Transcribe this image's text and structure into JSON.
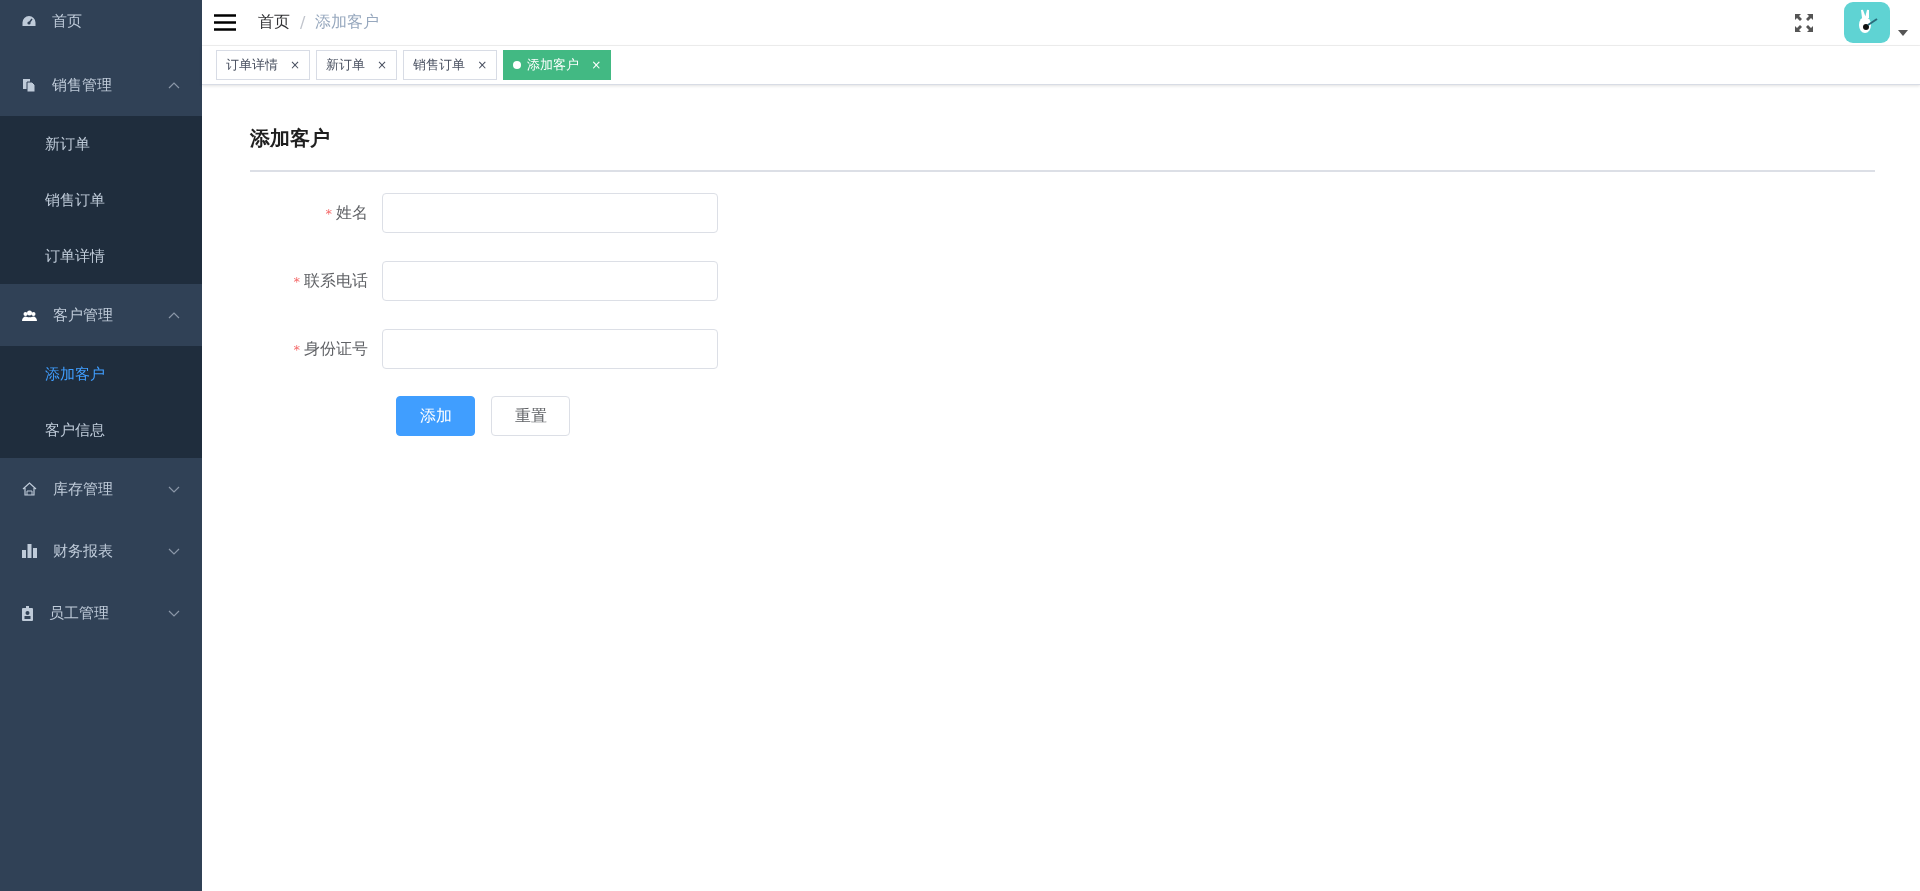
{
  "sidebar": {
    "items": [
      {
        "label": "首页",
        "selected": false
      },
      {
        "label": "销售管理",
        "expanded": true,
        "selected": false,
        "children": [
          {
            "label": "新订单",
            "selected": false
          },
          {
            "label": "销售订单",
            "selected": false
          },
          {
            "label": "订单详情",
            "selected": false
          }
        ]
      },
      {
        "label": "客户管理",
        "expanded": true,
        "selected": false,
        "children": [
          {
            "label": "添加客户",
            "selected": true
          },
          {
            "label": "客户信息",
            "selected": false
          }
        ]
      },
      {
        "label": "库存管理",
        "expanded": false,
        "selected": false
      },
      {
        "label": "财务报表",
        "expanded": false,
        "selected": false
      },
      {
        "label": "员工管理",
        "expanded": false,
        "selected": false
      }
    ]
  },
  "breadcrumb": {
    "separator": "/",
    "items": [
      "首页",
      "添加客户"
    ]
  },
  "tabs": [
    {
      "label": "订单详情",
      "selected": false,
      "close": "×"
    },
    {
      "label": "新订单",
      "selected": false,
      "close": "×"
    },
    {
      "label": "销售订单",
      "selected": false,
      "close": "×"
    },
    {
      "label": "添加客户",
      "selected": true,
      "close": "×"
    }
  ],
  "form": {
    "title": "添加客户",
    "fields": [
      {
        "label": "姓名",
        "required_mark": "*"
      },
      {
        "label": "联系电话",
        "required_mark": "*"
      },
      {
        "label": "身份证号",
        "required_mark": "*"
      }
    ],
    "buttons": [
      {
        "label": "添加",
        "kind": "primary"
      },
      {
        "label": "重置",
        "kind": "default"
      }
    ]
  }
}
